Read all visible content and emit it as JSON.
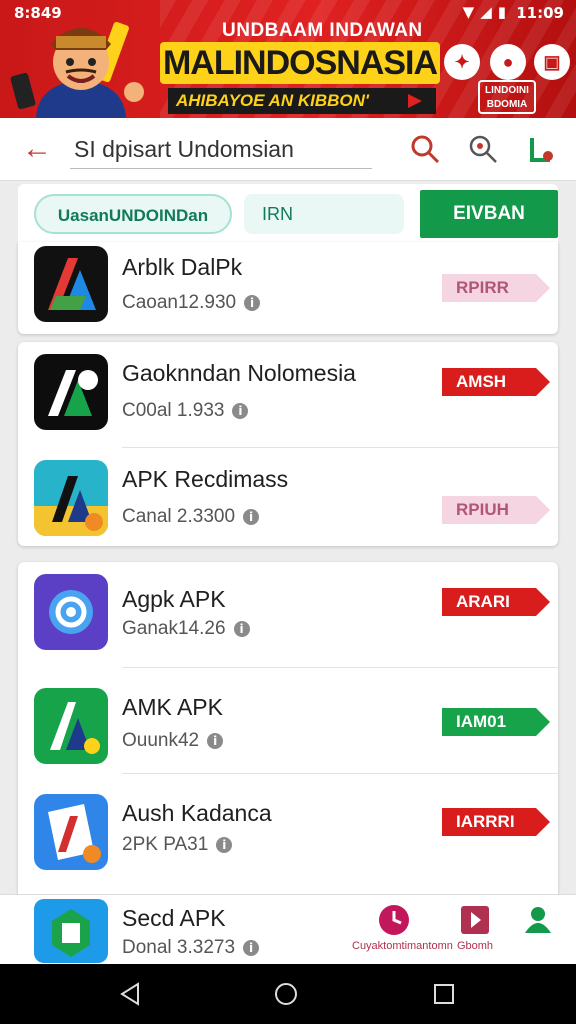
{
  "status_bar": {
    "time_left": "8:849",
    "time_right": "11:09"
  },
  "banner": {
    "top_line": "UNDBAAM INDAWAN",
    "title": "MALINDOSNASIA",
    "subtitle": "AHIBAYOE AN KIBBON'",
    "badge": "LINDOINI\nBDOMIA",
    "button_icons": [
      "trophy-icon",
      "chat-icon",
      "gift-icon"
    ]
  },
  "search": {
    "query": "SI dpisart Undomsian",
    "icons": [
      "search-icon",
      "zoom-icon",
      "profile-icon"
    ]
  },
  "filters": {
    "chip_primary": "UasanUNDOINDan",
    "chip_secondary": "IRN",
    "install_button": "EIVBAN"
  },
  "apps": [
    {
      "name": "Arblk DalPk",
      "meta": "Caoan12.930",
      "tag": "RPIRR",
      "tag_color": "pink"
    },
    {
      "name": "Gaoknndan Nolomesia",
      "meta": "C00al 1.933",
      "tag": "AMSH",
      "tag_color": "red"
    },
    {
      "name": "APK Recdimass",
      "meta": "Canal 2.3300",
      "tag": "RPIUH",
      "tag_color": "pink"
    },
    {
      "name": "Agpk APK",
      "meta": "Ganak14.26",
      "tag": "ARARI",
      "tag_color": "red"
    },
    {
      "name": "AMK APK",
      "meta": "Ouunk42",
      "tag": "IAM01",
      "tag_color": "green"
    },
    {
      "name": "Aush Kadanca",
      "meta": "2PK PA31",
      "tag": "IARRRI",
      "tag_color": "red"
    },
    {
      "name": "Secd APK",
      "meta": "Donal 3.3273"
    }
  ],
  "bottom_nav": [
    {
      "label": "Cuyaktomtimantomn",
      "icon": "clock-icon"
    },
    {
      "label": "Gbomh",
      "icon": "bookmark-icon"
    },
    {
      "label": "",
      "icon": "person-icon"
    }
  ],
  "colors": {
    "brand_red": "#d91d1d",
    "install_green": "#12994a",
    "banner_yellow": "#ffd21a"
  }
}
